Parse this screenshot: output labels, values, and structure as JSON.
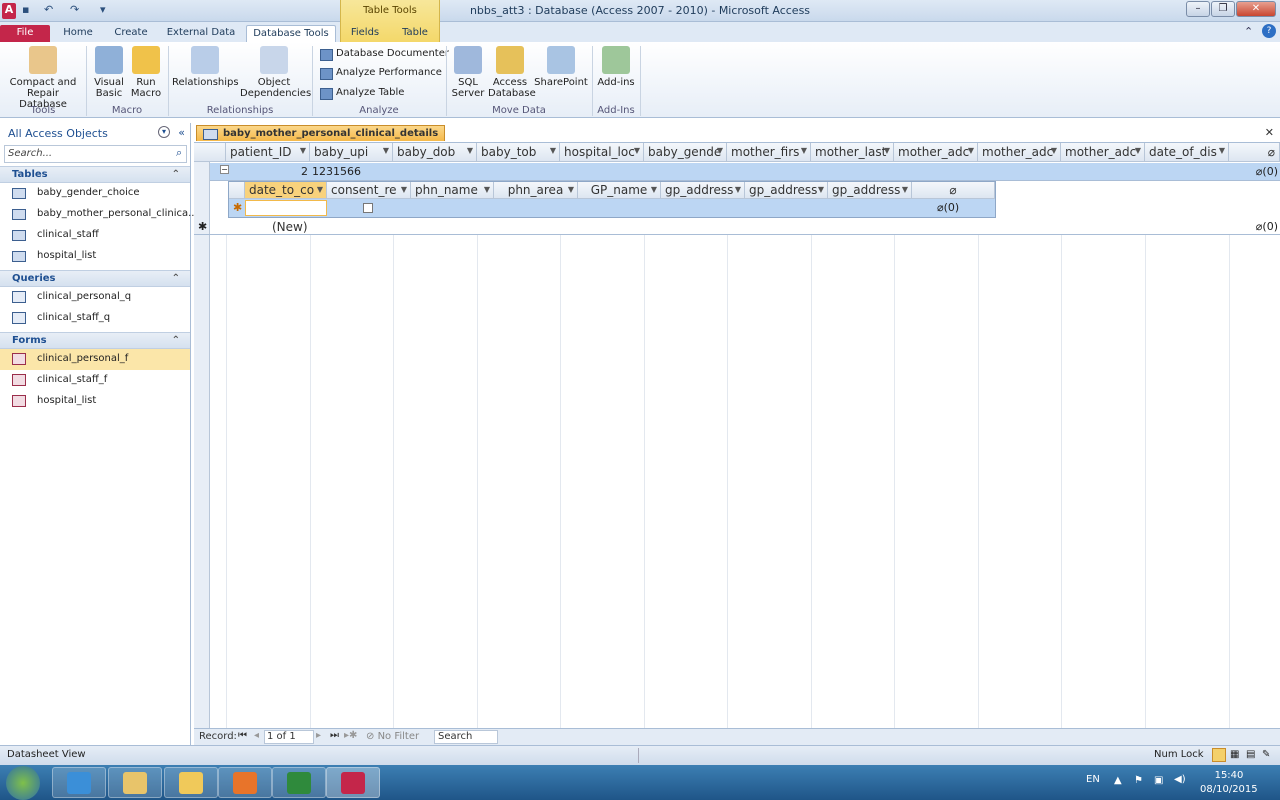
{
  "window": {
    "title": "nbbs_att3 : Database (Access 2007 - 2010) - Microsoft Access",
    "context_group": "Table Tools"
  },
  "ribbon_tabs": [
    "File",
    "Home",
    "Create",
    "External Data",
    "Database Tools",
    "Fields",
    "Table"
  ],
  "ribbon": {
    "compact_repair": "Compact and Repair Database",
    "visual_basic": "Visual Basic",
    "run_macro": "Run Macro",
    "relationships": "Relationships",
    "object_dependencies": "Object Dependencies",
    "database_documenter": "Database Documenter",
    "analyze_performance": "Analyze Performance",
    "analyze_table": "Analyze Table",
    "sql_server": "SQL Server",
    "access_database": "Access Database",
    "sharepoint": "SharePoint",
    "add_ins": "Add-ins",
    "groups": [
      "Tools",
      "Macro",
      "Relationships",
      "Analyze",
      "Move Data",
      "Add-Ins"
    ]
  },
  "nav": {
    "header": "All Access Objects",
    "search_placeholder": "Search...",
    "tables_label": "Tables",
    "tables": [
      "baby_gender_choice",
      "baby_mother_personal_clinica...",
      "clinical_staff",
      "hospital_list"
    ],
    "queries_label": "Queries",
    "queries": [
      "clinical_personal_q",
      "clinical_staff_q"
    ],
    "forms_label": "Forms",
    "forms": [
      "clinical_personal_f",
      "clinical_staff_f",
      "hospital_list"
    ]
  },
  "document_tab": "baby_mother_personal_clinical_details",
  "columns": [
    "patient_ID",
    "baby_upi",
    "baby_dob",
    "baby_tob",
    "hospital_loc",
    "baby_gende",
    "mother_firs",
    "mother_last",
    "mother_adc",
    "mother_adc",
    "mother_adc",
    "date_of_dis"
  ],
  "row1": {
    "patient_id": "2",
    "baby_upi": "1231566",
    "attach": "(0)"
  },
  "subcolumns": [
    "date_to_co",
    "consent_re",
    "phn_name",
    "phn_area",
    "GP_name",
    "gp_address",
    "gp_address",
    "gp_address"
  ],
  "subrow_attach": "(0)",
  "new_row_label": "(New)",
  "new_row_attach": "(0)",
  "record_nav": {
    "label": "Record:",
    "position": "1 of 1",
    "filter": "No Filter",
    "search": "Search"
  },
  "status": {
    "left": "Datasheet View",
    "numlock": "Num Lock"
  },
  "tray": {
    "lang": "EN",
    "time": "15:40",
    "date": "08/10/2015"
  }
}
